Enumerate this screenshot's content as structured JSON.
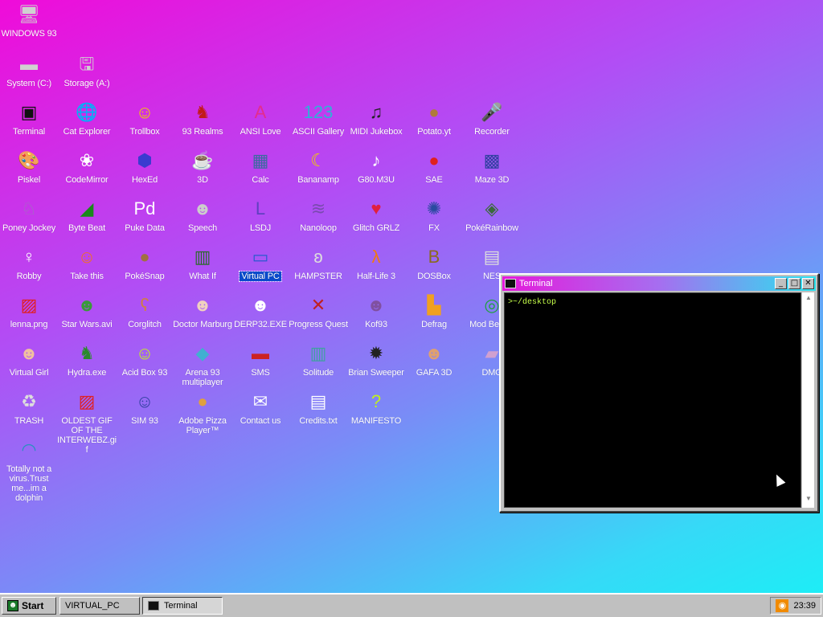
{
  "desktop": {
    "icons": [
      {
        "id": "windows93",
        "label": "WINDOWS 93",
        "glyph": "🖥",
        "color": "#d0d0d0"
      },
      {
        "id": "system-c",
        "label": "System (C:)",
        "glyph": "▬",
        "color": "#d0d0d0"
      },
      {
        "id": "storage-a",
        "label": "Storage (A:)",
        "glyph": "🖫",
        "color": "#d0d0d0"
      },
      {
        "id": "terminal",
        "label": "Terminal",
        "glyph": "▣",
        "color": "#111111"
      },
      {
        "id": "cat-explorer",
        "label": "Cat Explorer",
        "glyph": "🌐",
        "color": "#3b8a3b"
      },
      {
        "id": "trollbox",
        "label": "Trollbox",
        "glyph": "☺",
        "color": "#f0d000"
      },
      {
        "id": "93-realms",
        "label": "93 Realms",
        "glyph": "♞",
        "color": "#c21a1a"
      },
      {
        "id": "ansi-love",
        "label": "ANSI Love",
        "glyph": "A",
        "color": "#e22d8e"
      },
      {
        "id": "ascii-gallery",
        "label": "ASCII Gallery",
        "glyph": "123",
        "color": "#2fb0d8"
      },
      {
        "id": "midi-jukebox",
        "label": "MIDI Jukebox",
        "glyph": "♫",
        "color": "#222222"
      },
      {
        "id": "potato-yt",
        "label": "Potato.yt",
        "glyph": "●",
        "color": "#b07a3a"
      },
      {
        "id": "recorder",
        "label": "Recorder",
        "glyph": "🎤",
        "color": "#444444"
      },
      {
        "id": "piskel",
        "label": "Piskel",
        "glyph": "🎨",
        "color": "#c08a40"
      },
      {
        "id": "codemirror",
        "label": "CodeMirror",
        "glyph": "❀",
        "color": "#ffffff"
      },
      {
        "id": "hexed",
        "label": "HexEd",
        "glyph": "⬢",
        "color": "#3b3bd0"
      },
      {
        "id": "3d",
        "label": "3D",
        "glyph": "☕",
        "color": "#e0a0b0"
      },
      {
        "id": "calc",
        "label": "Calc",
        "glyph": "▦",
        "color": "#3b6aa0"
      },
      {
        "id": "bananamp",
        "label": "Bananamp",
        "glyph": "☾",
        "color": "#f0d000"
      },
      {
        "id": "g80-m3u",
        "label": "G80.M3U",
        "glyph": "♪",
        "color": "#ffffff"
      },
      {
        "id": "sae",
        "label": "SAE",
        "glyph": "●",
        "color": "#e02020"
      },
      {
        "id": "maze-3d",
        "label": "Maze 3D",
        "glyph": "▩",
        "color": "#3040a0"
      },
      {
        "id": "poney-jockey",
        "label": "Poney Jockey",
        "glyph": "♘",
        "color": "#a070c0"
      },
      {
        "id": "byte-beat",
        "label": "Byte Beat",
        "glyph": "◢",
        "color": "#1a8a1a"
      },
      {
        "id": "puke-data",
        "label": "Puke Data",
        "glyph": "Pd",
        "color": "#ffffff"
      },
      {
        "id": "speech",
        "label": "Speech",
        "glyph": "☻",
        "color": "#cccccc"
      },
      {
        "id": "lsdj",
        "label": "LSDJ",
        "glyph": "L",
        "color": "#6040c0"
      },
      {
        "id": "nanoloop",
        "label": "Nanoloop",
        "glyph": "≋",
        "color": "#7a4ab0"
      },
      {
        "id": "glitch-grlz",
        "label": "Glitch GRLZ",
        "glyph": "♥",
        "color": "#e02040"
      },
      {
        "id": "fx",
        "label": "FX",
        "glyph": "✺",
        "color": "#2a4aa0"
      },
      {
        "id": "pokerainbow",
        "label": "PokéRainbow",
        "glyph": "◈",
        "color": "#3a6a3a"
      },
      {
        "id": "robby",
        "label": "Robby",
        "glyph": "♀",
        "color": "#ffffff"
      },
      {
        "id": "take-this",
        "label": "Take this",
        "glyph": "☺",
        "color": "#f07020"
      },
      {
        "id": "pokesnap",
        "label": "PokéSnap",
        "glyph": "●",
        "color": "#a07040"
      },
      {
        "id": "what-if",
        "label": "What If",
        "glyph": "▥",
        "color": "#2a6a2a"
      },
      {
        "id": "virtual-pc",
        "label": "Virtual PC",
        "glyph": "▭",
        "color": "#2a5ad0"
      },
      {
        "id": "hampster",
        "label": "HAMPSTER",
        "glyph": "ʚ",
        "color": "#dddddd"
      },
      {
        "id": "half-life-3",
        "label": "Half-Life 3",
        "glyph": "λ",
        "color": "#f07a10"
      },
      {
        "id": "dosbox",
        "label": "DOSBox",
        "glyph": "B",
        "color": "#8a6a20"
      },
      {
        "id": "nes",
        "label": "NES",
        "glyph": "▤",
        "color": "#dddddd"
      },
      {
        "id": "lenna-png",
        "label": "lenna.png",
        "glyph": "▨",
        "color": "#e02020"
      },
      {
        "id": "star-wars-avi",
        "label": "Star Wars.avi",
        "glyph": "☻",
        "color": "#3a9a3a"
      },
      {
        "id": "corglitch",
        "label": "Corglitch",
        "glyph": "ʕ",
        "color": "#d08040"
      },
      {
        "id": "doctor-marburg",
        "label": "Doctor Marburg",
        "glyph": "☻",
        "color": "#f0d0c0"
      },
      {
        "id": "derp32-exe",
        "label": "DERP32.EXE",
        "glyph": "☻",
        "color": "#ffffff"
      },
      {
        "id": "progress-quest",
        "label": "Progress Quest",
        "glyph": "✕",
        "color": "#c02020"
      },
      {
        "id": "kof93",
        "label": "Kof93",
        "glyph": "☻",
        "color": "#8050a0"
      },
      {
        "id": "defrag",
        "label": "Defrag",
        "glyph": "▙",
        "color": "#f0a020"
      },
      {
        "id": "mod-beep",
        "label": "Mod BeepB",
        "glyph": "◎",
        "color": "#20a040"
      },
      {
        "id": "virtual-girl",
        "label": "Virtual Girl",
        "glyph": "☻",
        "color": "#f0c0a0"
      },
      {
        "id": "hydra-exe",
        "label": "Hydra.exe",
        "glyph": "♞",
        "color": "#2a8a2a"
      },
      {
        "id": "acid-box-93",
        "label": "Acid Box 93",
        "glyph": "☺",
        "color": "#c0f020"
      },
      {
        "id": "arena-93",
        "label": "Arena 93 multiplayer",
        "glyph": "◆",
        "color": "#40b0d0"
      },
      {
        "id": "sms",
        "label": "SMS",
        "glyph": "▬",
        "color": "#cc2222"
      },
      {
        "id": "solitude",
        "label": "Solitude",
        "glyph": "▥",
        "color": "#40a0a0"
      },
      {
        "id": "brian-sweeper",
        "label": "Brian Sweeper",
        "glyph": "✹",
        "color": "#222222"
      },
      {
        "id": "gafa-3d",
        "label": "GAFA 3D",
        "glyph": "☻",
        "color": "#e0a070"
      },
      {
        "id": "dmg",
        "label": "DMG",
        "glyph": "▰",
        "color": "#d0a0d0"
      },
      {
        "id": "trash",
        "label": "TRASH",
        "glyph": "♻",
        "color": "#dddddd"
      },
      {
        "id": "oldest-gif",
        "label": "OLDEST GIF OF THE INTERWEBZ.gif",
        "glyph": "▨",
        "color": "#e02020"
      },
      {
        "id": "sim-93",
        "label": "SIM 93",
        "glyph": "☺",
        "color": "#3040a0"
      },
      {
        "id": "adobe-pizza",
        "label": "Adobe Pizza Player™",
        "glyph": "●",
        "color": "#e0a040"
      },
      {
        "id": "contact-us",
        "label": "Contact us",
        "glyph": "✉",
        "color": "#ffffff"
      },
      {
        "id": "credits-txt",
        "label": "Credits.txt",
        "glyph": "▤",
        "color": "#ffffff"
      },
      {
        "id": "manifesto",
        "label": "MANIFESTO",
        "glyph": "?",
        "color": "#c0f020"
      },
      {
        "id": "dolphin",
        "label": "Totally not a virus.Trust me...im a dolphin",
        "glyph": "◠",
        "color": "#2a90c0"
      }
    ]
  },
  "terminal_window": {
    "title": "Terminal",
    "prompt_line": ">~/desktop",
    "minimize": "_",
    "maximize": "□",
    "close": "✕"
  },
  "taskbar": {
    "start_label": "Start",
    "items": [
      "VIRTUAL_PC",
      "Terminal"
    ],
    "clock": "23:39"
  }
}
